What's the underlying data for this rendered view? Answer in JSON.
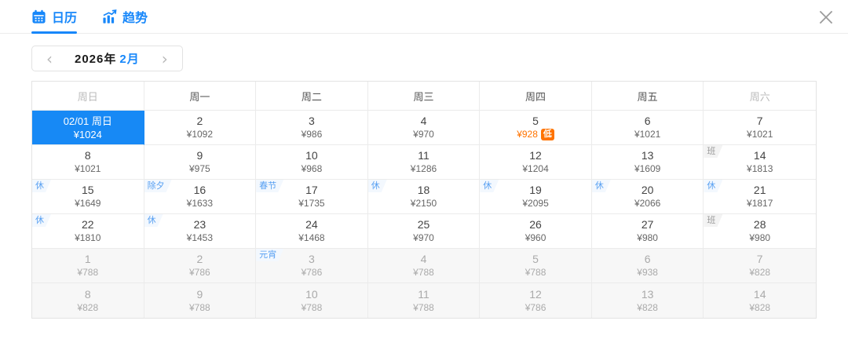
{
  "tabs": {
    "calendar": {
      "label": "日历",
      "icon": "calendar-icon",
      "active": true
    },
    "trend": {
      "label": "趋势",
      "icon": "trend-chart-icon",
      "active": false
    }
  },
  "close": {
    "icon": "close-icon"
  },
  "month_nav": {
    "year": "2026年",
    "month": "2月",
    "prev": "‹",
    "next": "›"
  },
  "colors": {
    "accent_blue": "#1787fa",
    "selected_cell_bg": "#1789f5",
    "low_price_orange": "#ff7300",
    "muted_row_bg": "#f7f7f7"
  },
  "calendar": {
    "weekday_headers": [
      {
        "label": "周日",
        "muted": true
      },
      {
        "label": "周一",
        "muted": false
      },
      {
        "label": "周二",
        "muted": false
      },
      {
        "label": "周三",
        "muted": false
      },
      {
        "label": "周四",
        "muted": false
      },
      {
        "label": "周五",
        "muted": false
      },
      {
        "label": "周六",
        "muted": true
      }
    ],
    "weeks": [
      [
        {
          "day": "02/01 周日",
          "price": "¥1024",
          "selected": true
        },
        {
          "day": "2",
          "price": "¥1092"
        },
        {
          "day": "3",
          "price": "¥986"
        },
        {
          "day": "4",
          "price": "¥970"
        },
        {
          "day": "5",
          "price": "¥928",
          "low": true,
          "low_badge": "低"
        },
        {
          "day": "6",
          "price": "¥1021"
        },
        {
          "day": "7",
          "price": "¥1021"
        }
      ],
      [
        {
          "day": "8",
          "price": "¥1021"
        },
        {
          "day": "9",
          "price": "¥975"
        },
        {
          "day": "10",
          "price": "¥968"
        },
        {
          "day": "11",
          "price": "¥1286"
        },
        {
          "day": "12",
          "price": "¥1204"
        },
        {
          "day": "13",
          "price": "¥1609"
        },
        {
          "day": "14",
          "price": "¥1813",
          "badge": {
            "text": "班",
            "type": "work"
          }
        }
      ],
      [
        {
          "day": "15",
          "price": "¥1649",
          "badge": {
            "text": "休",
            "type": "rest"
          }
        },
        {
          "day": "16",
          "price": "¥1633",
          "badge": {
            "text": "除夕",
            "type": "festival"
          }
        },
        {
          "day": "17",
          "price": "¥1735",
          "badge": {
            "text": "春节",
            "type": "festival"
          }
        },
        {
          "day": "18",
          "price": "¥2150",
          "badge": {
            "text": "休",
            "type": "rest"
          }
        },
        {
          "day": "19",
          "price": "¥2095",
          "badge": {
            "text": "休",
            "type": "rest"
          }
        },
        {
          "day": "20",
          "price": "¥2066",
          "badge": {
            "text": "休",
            "type": "rest"
          }
        },
        {
          "day": "21",
          "price": "¥1817",
          "badge": {
            "text": "休",
            "type": "rest"
          }
        }
      ],
      [
        {
          "day": "22",
          "price": "¥1810",
          "badge": {
            "text": "休",
            "type": "rest"
          }
        },
        {
          "day": "23",
          "price": "¥1453",
          "badge": {
            "text": "休",
            "type": "rest"
          }
        },
        {
          "day": "24",
          "price": "¥1468"
        },
        {
          "day": "25",
          "price": "¥970"
        },
        {
          "day": "26",
          "price": "¥960"
        },
        {
          "day": "27",
          "price": "¥980"
        },
        {
          "day": "28",
          "price": "¥980",
          "badge": {
            "text": "班",
            "type": "work"
          }
        }
      ],
      [
        {
          "day": "1",
          "price": "¥788",
          "muted": true
        },
        {
          "day": "2",
          "price": "¥786",
          "muted": true
        },
        {
          "day": "3",
          "price": "¥786",
          "muted": true,
          "badge": {
            "text": "元宵",
            "type": "festival"
          }
        },
        {
          "day": "4",
          "price": "¥788",
          "muted": true
        },
        {
          "day": "5",
          "price": "¥788",
          "muted": true
        },
        {
          "day": "6",
          "price": "¥938",
          "muted": true
        },
        {
          "day": "7",
          "price": "¥828",
          "muted": true
        }
      ],
      [
        {
          "day": "8",
          "price": "¥828",
          "muted": true
        },
        {
          "day": "9",
          "price": "¥788",
          "muted": true
        },
        {
          "day": "10",
          "price": "¥788",
          "muted": true
        },
        {
          "day": "11",
          "price": "¥788",
          "muted": true
        },
        {
          "day": "12",
          "price": "¥786",
          "muted": true
        },
        {
          "day": "13",
          "price": "¥828",
          "muted": true
        },
        {
          "day": "14",
          "price": "¥828",
          "muted": true
        }
      ]
    ]
  }
}
